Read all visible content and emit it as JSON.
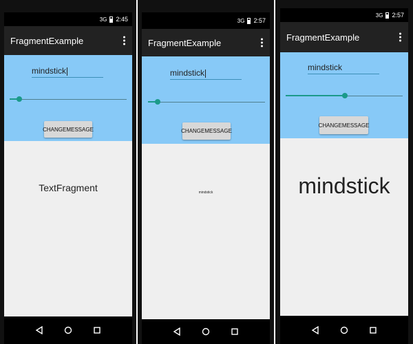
{
  "phones": [
    {
      "time": "2:45",
      "signal": "3G",
      "app_title": "FragmentExample",
      "edit_text": "mindstick",
      "seek_fraction": 0.07,
      "button_label": "CHANGEMESSAGE",
      "display_text": "TextFragment"
    },
    {
      "time": "2:57",
      "signal": "3G",
      "app_title": "FragmentExample",
      "edit_text": "mindstick",
      "seek_fraction": 0.07,
      "button_label": "CHANGEMESSAGE",
      "display_text": "mindstick"
    },
    {
      "time": "2:57",
      "signal": "3G",
      "app_title": "FragmentExample",
      "edit_text": "mindstick",
      "seek_fraction": 0.5,
      "button_label": "CHANGEMESSAGE",
      "display_text": "mindstick"
    }
  ],
  "colors": {
    "top_fragment_bg": "#87c9f7",
    "bottom_fragment_bg": "#efefef",
    "seek_accent": "#1b9a8a"
  }
}
